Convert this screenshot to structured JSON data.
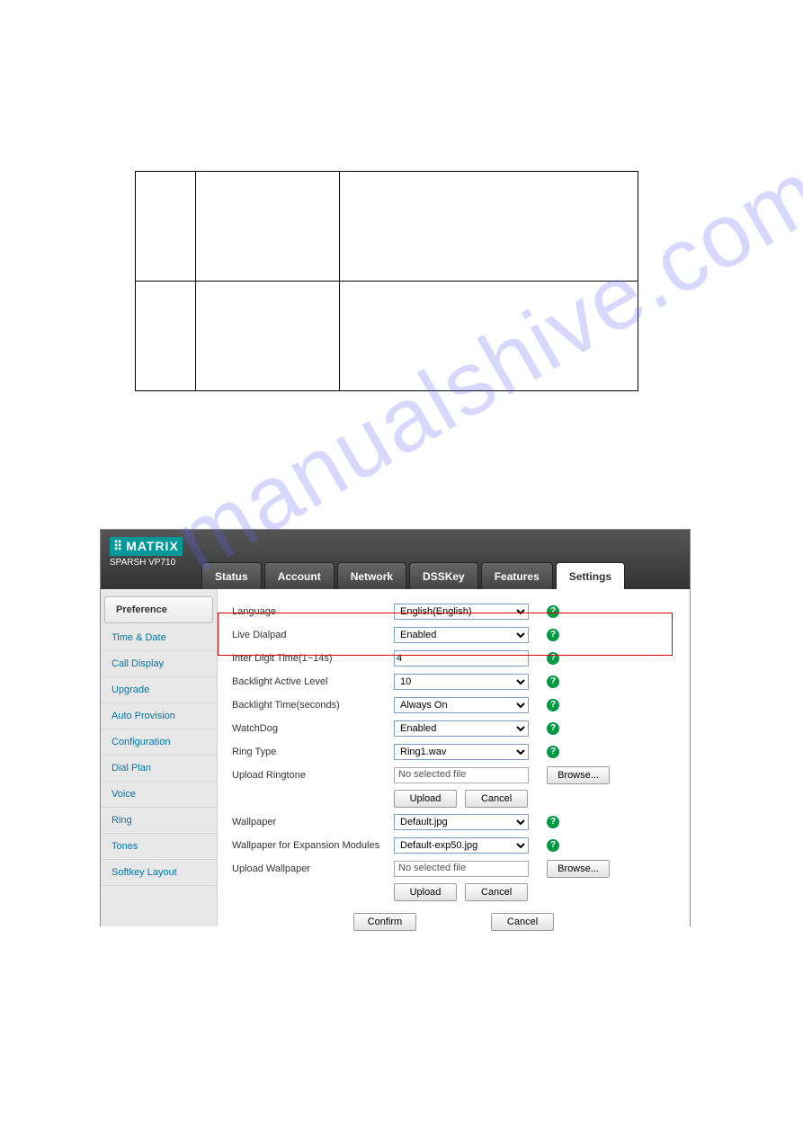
{
  "watermark": "manualshive.com",
  "brand": {
    "logo": "MATRIX",
    "model": "SPARSH VP710"
  },
  "tabs": [
    {
      "label": "Status"
    },
    {
      "label": "Account"
    },
    {
      "label": "Network"
    },
    {
      "label": "DSSKey"
    },
    {
      "label": "Features"
    },
    {
      "label": "Settings",
      "active": true
    }
  ],
  "sidebar": [
    {
      "label": "Preference",
      "active": true
    },
    {
      "label": "Time & Date"
    },
    {
      "label": "Call Display"
    },
    {
      "label": "Upgrade"
    },
    {
      "label": "Auto Provision"
    },
    {
      "label": "Configuration"
    },
    {
      "label": "Dial Plan"
    },
    {
      "label": "Voice"
    },
    {
      "label": "Ring"
    },
    {
      "label": "Tones"
    },
    {
      "label": "Softkey Layout"
    }
  ],
  "settings": {
    "language": {
      "label": "Language",
      "value": "English(English)"
    },
    "live_dialpad": {
      "label": "Live Dialpad",
      "value": "Enabled"
    },
    "inter_digit": {
      "label": "Inter Digit Time(1~14s)",
      "value": "4"
    },
    "backlight_level": {
      "label": "Backlight Active Level",
      "value": "10"
    },
    "backlight_time": {
      "label": "Backlight Time(seconds)",
      "value": "Always On"
    },
    "watchdog": {
      "label": "WatchDog",
      "value": "Enabled"
    },
    "ring_type": {
      "label": "Ring Type",
      "value": "Ring1.wav"
    },
    "upload_ringtone": {
      "label": "Upload Ringtone",
      "value": "No selected file"
    },
    "wallpaper": {
      "label": "Wallpaper",
      "value": "Default.jpg"
    },
    "wallpaper_exp": {
      "label": "Wallpaper for Expansion Modules",
      "value": "Default-exp50.jpg"
    },
    "upload_wallpaper": {
      "label": "Upload Wallpaper",
      "value": "No selected file"
    }
  },
  "buttons": {
    "browse": "Browse...",
    "upload": "Upload",
    "cancel": "Cancel",
    "confirm": "Confirm"
  }
}
